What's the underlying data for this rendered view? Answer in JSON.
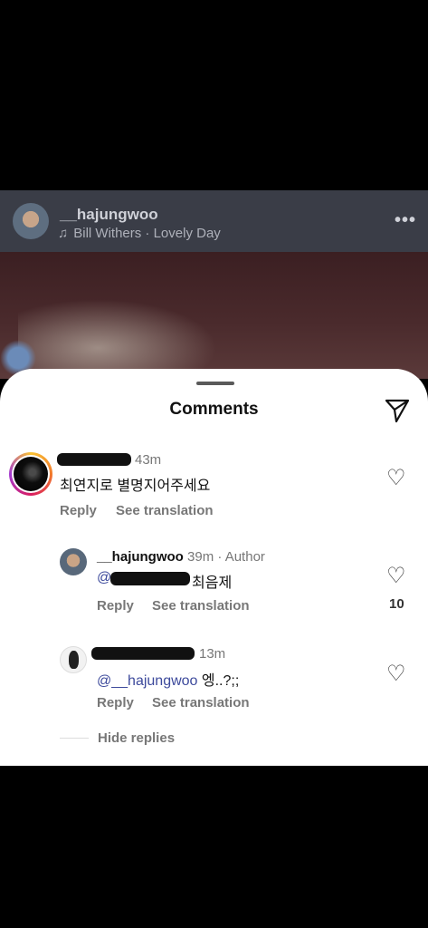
{
  "post": {
    "username": "__hajungwoo",
    "music": "Bill Withers · Lovely Day"
  },
  "sheet": {
    "title": "Comments"
  },
  "comments": [
    {
      "time": "43m",
      "text": "최연지로 별명지어주세요",
      "reply_label": "Reply",
      "translate_label": "See translation"
    }
  ],
  "replies": [
    {
      "username": "__hajungwoo",
      "time": "39m",
      "author_tag": "· Author",
      "mention": "@",
      "text": "최음제",
      "reply_label": "Reply",
      "translate_label": "See translation",
      "likes": "10"
    },
    {
      "time": "13m",
      "mention": "@__hajungwoo",
      "text": " 엥..?;;",
      "reply_label": "Reply",
      "translate_label": "See translation"
    }
  ],
  "hide_replies_label": "Hide replies",
  "icons": {
    "music": "music-note-icon",
    "more": "more-horizontal-icon",
    "send": "paper-plane-icon",
    "like": "heart-outline-icon"
  }
}
